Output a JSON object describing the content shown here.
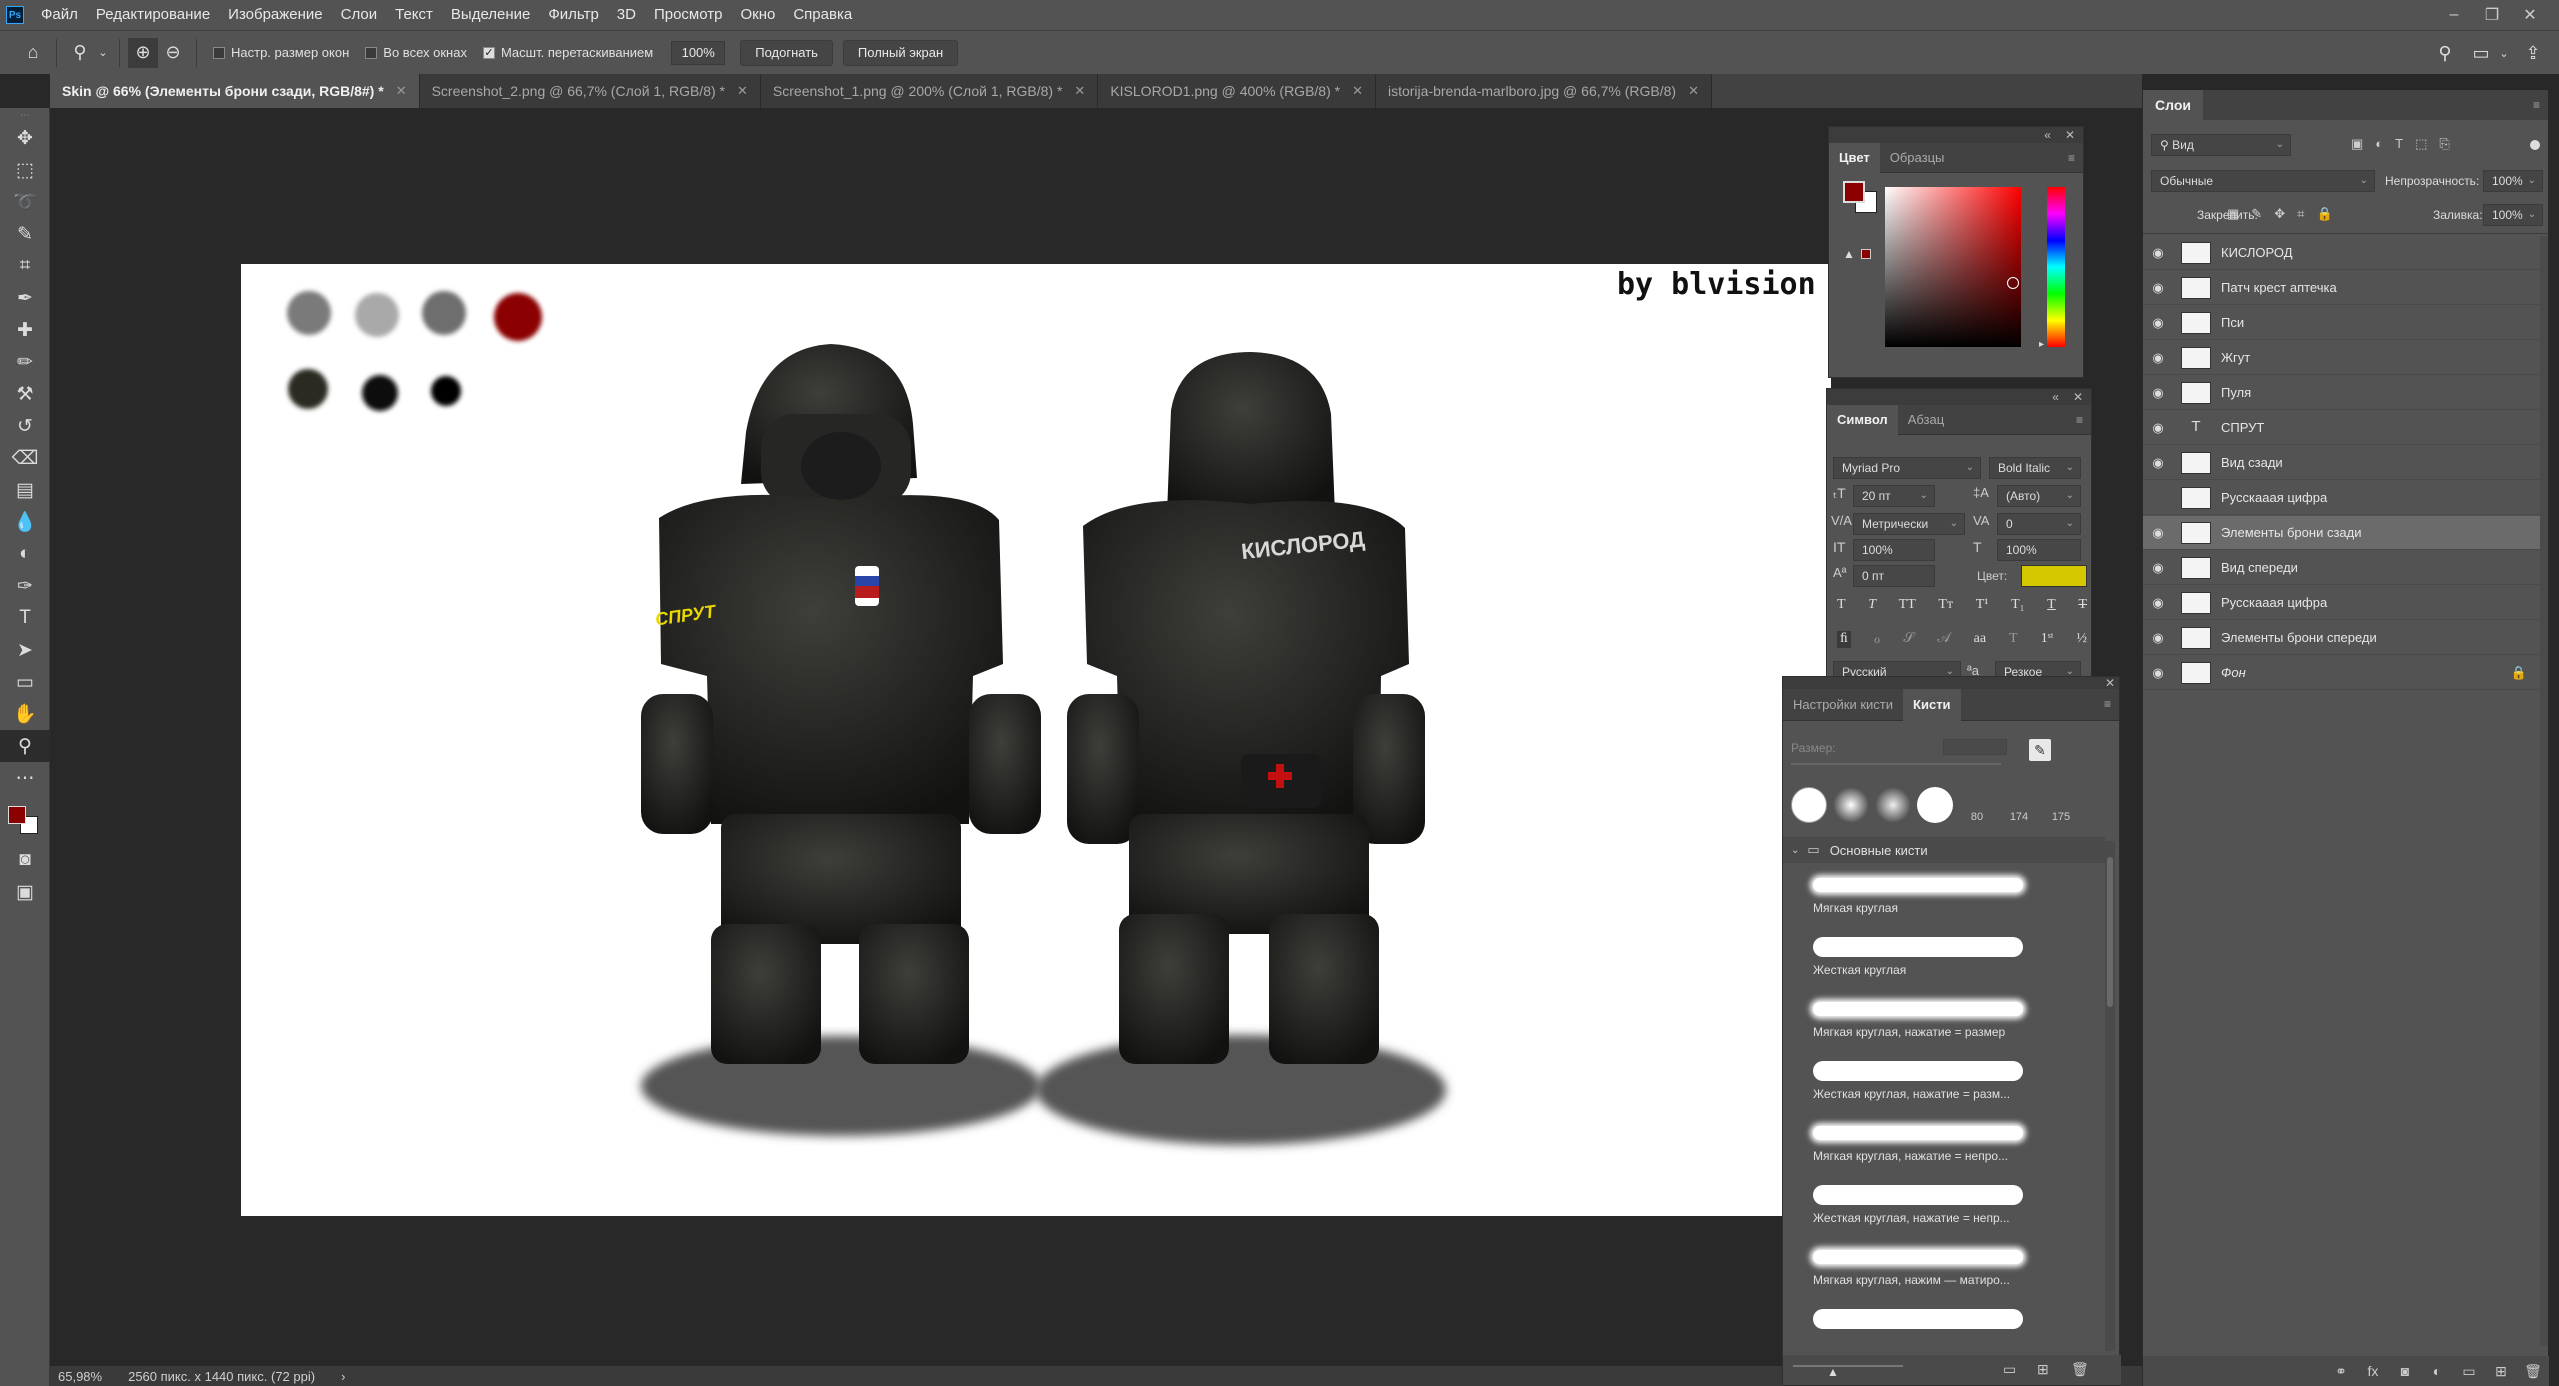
{
  "menu": [
    "Файл",
    "Редактирование",
    "Изображение",
    "Слои",
    "Текст",
    "Выделение",
    "Фильтр",
    "3D",
    "Просмотр",
    "Окно",
    "Справка"
  ],
  "app_logo": "Ps",
  "options": {
    "check_resize": "Настр. размер окон",
    "check_all_windows": "Во всех окнах",
    "check_scrubby": "Масшт. перетаскиванием",
    "zoom_value": "100%",
    "fit_button": "Подогнать",
    "fullscreen_button": "Полный экран"
  },
  "tabs": [
    {
      "label": "Skin @ 66% (Элементы брони сзади, RGB/8#) *",
      "active": true
    },
    {
      "label": "Screenshot_2.png @ 66,7% (Слой 1, RGB/8) *",
      "active": false
    },
    {
      "label": "Screenshot_1.png @ 200% (Слой 1, RGB/8) *",
      "active": false
    },
    {
      "label": "KISLOROD1.png @ 400% (RGB/8) *",
      "active": false
    },
    {
      "label": "istorija-brenda-marlboro.jpg @ 66,7% (RGB/8)",
      "active": false
    }
  ],
  "canvas": {
    "signature": "by blvision",
    "front_patch_label": "СПРУТ",
    "back_patch_label": "КИСЛОРОД"
  },
  "status": {
    "zoom": "65,98%",
    "doc_size": "2560 пикс. x 1440 пикс. (72 ppi)"
  },
  "color_panel": {
    "tab_color": "Цвет",
    "tab_swatches": "Образцы",
    "foreground": "#8b0000",
    "background": "#ffffff"
  },
  "character_panel": {
    "tab_character": "Символ",
    "tab_paragraph": "Абзац",
    "font_family": "Myriad Pro",
    "font_style": "Bold Italic",
    "font_size": "20 пт",
    "leading": "(Авто)",
    "kerning": "Метрически",
    "tracking": "0",
    "vscale": "100%",
    "hscale": "100%",
    "baseline": "0 пт",
    "color_label": "Цвет:",
    "color_value": "#d4c800",
    "language": "Русский",
    "aa_label": "ªa",
    "antialias": "Резкое"
  },
  "brush_panel": {
    "tab_settings": "Настройки кисти",
    "tab_brushes": "Кисти",
    "size_label": "Размер:",
    "preset_sizes": [
      "80",
      "174",
      "175"
    ],
    "group_name": "Основные кисти",
    "brushes": [
      {
        "name": "Мягкая круглая",
        "soft": true
      },
      {
        "name": "Жесткая круглая",
        "soft": false
      },
      {
        "name": "Мягкая круглая, нажатие = размер",
        "soft": true
      },
      {
        "name": "Жесткая круглая, нажатие = разм...",
        "soft": false
      },
      {
        "name": "Мягкая круглая, нажатие = непро...",
        "soft": true
      },
      {
        "name": "Жесткая круглая, нажатие = непр...",
        "soft": false
      },
      {
        "name": "Мягкая круглая, нажим — матиро...",
        "soft": true
      },
      {
        "name": "",
        "soft": false
      }
    ]
  },
  "layers_panel": {
    "tab": "Слои",
    "filter": "Вид",
    "blend_mode": "Обычные",
    "opacity_label": "Непрозрачность:",
    "opacity": "100%",
    "lock_label": "Закрепить:",
    "fill_label": "Заливка:",
    "fill": "100%",
    "layers": [
      {
        "name": "КИСЛОРОД",
        "visible": true,
        "type": "pixel",
        "selected": false
      },
      {
        "name": "Патч крест аптечка",
        "visible": true,
        "type": "pixel",
        "selected": false
      },
      {
        "name": "Пси",
        "visible": true,
        "type": "pixel",
        "selected": false
      },
      {
        "name": "Жгут",
        "visible": true,
        "type": "pixel",
        "selected": false
      },
      {
        "name": "Пуля",
        "visible": true,
        "type": "pixel",
        "selected": false
      },
      {
        "name": "СПРУТ",
        "visible": true,
        "type": "text",
        "selected": false
      },
      {
        "name": "Вид сзади",
        "visible": true,
        "type": "pixel",
        "selected": false
      },
      {
        "name": "Русскааая цифра",
        "visible": false,
        "type": "pixel",
        "selected": false
      },
      {
        "name": "Элементы брони сзади",
        "visible": true,
        "type": "pixel",
        "selected": true
      },
      {
        "name": "Вид спереди",
        "visible": true,
        "type": "pixel",
        "selected": false
      },
      {
        "name": "Русскааая цифра",
        "visible": true,
        "type": "pixel",
        "selected": false
      },
      {
        "name": "Элементы брони спереди",
        "visible": true,
        "type": "pixel",
        "selected": false
      },
      {
        "name": "Фон",
        "visible": true,
        "type": "pixel",
        "selected": false,
        "locked": true
      }
    ]
  }
}
